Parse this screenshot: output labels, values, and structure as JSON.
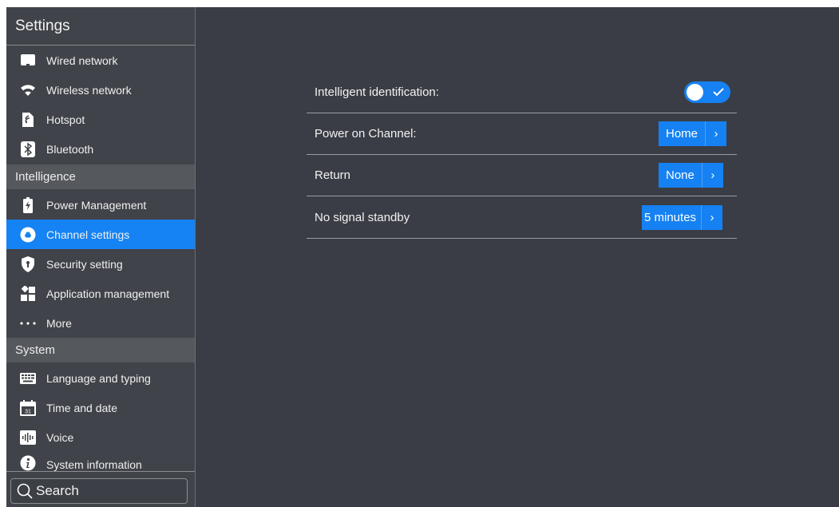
{
  "sidebar": {
    "title": "Settings",
    "items": [
      {
        "label": "Wired network",
        "icon": "monitor-icon"
      },
      {
        "label": "Wireless network",
        "icon": "wifi-icon"
      },
      {
        "label": "Hotspot",
        "icon": "hotspot-icon"
      },
      {
        "label": "Bluetooth",
        "icon": "bluetooth-icon"
      }
    ],
    "section_intelligence": "Intelligence",
    "intelligence_items": [
      {
        "label": "Power Management",
        "icon": "battery-icon"
      },
      {
        "label": "Channel settings",
        "icon": "channel-icon"
      },
      {
        "label": "Security setting",
        "icon": "shield-icon"
      },
      {
        "label": "Application management",
        "icon": "apps-icon"
      },
      {
        "label": "More",
        "icon": "more-icon"
      }
    ],
    "section_system": "System",
    "system_items": [
      {
        "label": "Language and typing",
        "icon": "keyboard-icon"
      },
      {
        "label": "Time and date",
        "icon": "calendar-icon"
      },
      {
        "label": "Voice",
        "icon": "voice-icon"
      },
      {
        "label": "System information",
        "icon": "info-icon"
      }
    ],
    "calendar_day": "31",
    "search_placeholder": "Search",
    "active_item": "Channel settings",
    "accent_color": "#1583f3"
  },
  "main": {
    "rows": [
      {
        "label": "Intelligent identification:",
        "control": "toggle",
        "value": true
      },
      {
        "label": "Power on Channel:",
        "control": "button",
        "value": "Home"
      },
      {
        "label": "Return",
        "control": "button",
        "value": "None"
      },
      {
        "label": "No signal standby",
        "control": "button",
        "value": "5 minutes"
      }
    ],
    "arrow_glyph": "›"
  }
}
